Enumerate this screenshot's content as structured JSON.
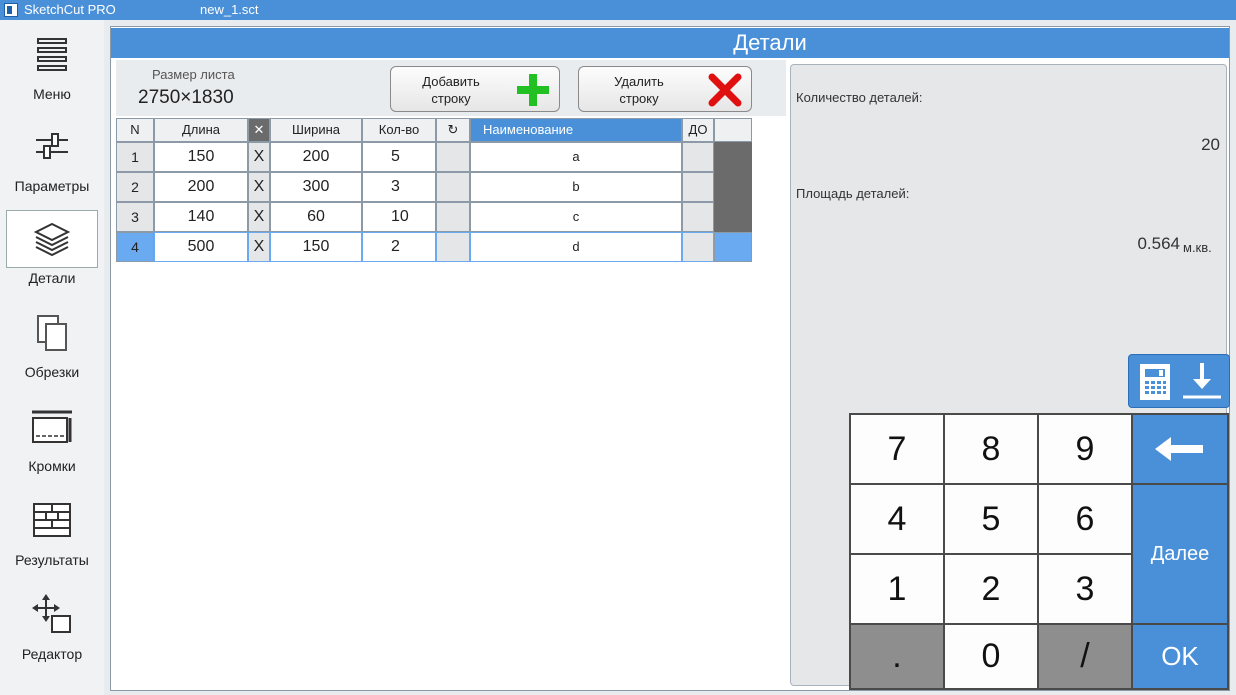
{
  "titlebar": {
    "app_name": "SketchCut PRO",
    "file_name": "new_1.sct"
  },
  "sidebar": {
    "items": [
      {
        "label": "Меню",
        "icon": "hamburger-icon"
      },
      {
        "label": "Параметры",
        "icon": "sliders-icon"
      },
      {
        "label": "Детали",
        "icon": "layers-icon",
        "active": true
      },
      {
        "label": "Обрезки",
        "icon": "offcuts-icon"
      },
      {
        "label": "Кромки",
        "icon": "edges-icon"
      },
      {
        "label": "Результаты",
        "icon": "results-grid-icon"
      },
      {
        "label": "Редактор",
        "icon": "move-editor-icon"
      }
    ]
  },
  "header": {
    "title": "Детали"
  },
  "sheet": {
    "label": "Размер листа",
    "value": "2750×1830"
  },
  "toolbar": {
    "add_label_line1": "Добавить",
    "add_label_line2": "строку",
    "delete_label_line1": "Удалить",
    "delete_label_line2": "строку"
  },
  "table": {
    "headers": {
      "n": "N",
      "length": "Длина",
      "x": "✕",
      "width": "Ширина",
      "qty": "Кол-во",
      "rotate": "↻",
      "name": "Наименование",
      "do": "ДО"
    },
    "rows": [
      {
        "n": "1",
        "length": "150",
        "x": "X",
        "width": "200",
        "qty": "5",
        "name": "a"
      },
      {
        "n": "2",
        "length": "200",
        "x": "X",
        "width": "300",
        "qty": "3",
        "name": "b"
      },
      {
        "n": "3",
        "length": "140",
        "x": "X",
        "width": "60",
        "qty": "10",
        "name": "c"
      },
      {
        "n": "4",
        "length": "500",
        "x": "X",
        "width": "150",
        "qty": "2",
        "name": "d",
        "selected": true
      }
    ]
  },
  "info": {
    "count_label": "Количество деталей:",
    "count_value": "20",
    "area_label": "Площадь деталей:",
    "area_value": "0.564",
    "area_unit": "м.кв."
  },
  "keypad": {
    "keys": [
      "7",
      "8",
      "9",
      "4",
      "5",
      "6",
      "1",
      "2",
      "3",
      ".",
      "0",
      "/"
    ],
    "next_label": "Далее",
    "ok_label": "OK"
  },
  "colors": {
    "accent": "#4a90d9",
    "selected_row": "#6aaaf0",
    "delete": "#e01010",
    "add": "#22c022"
  }
}
